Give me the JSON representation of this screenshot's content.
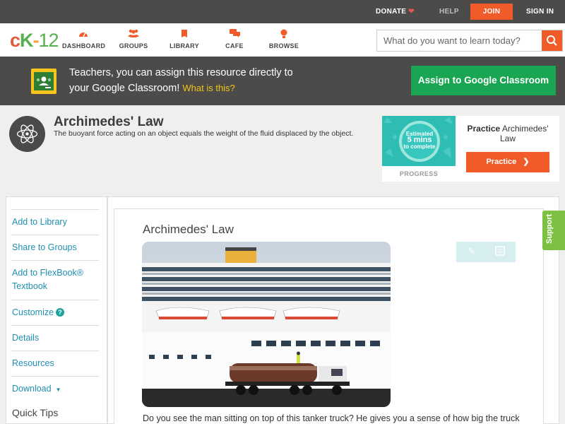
{
  "topbar": {
    "donate": "DONATE",
    "help": "HELP",
    "join": "JOIN",
    "signin": "SIGN IN"
  },
  "nav": {
    "logo": {
      "c": "c",
      "k": "K",
      "n": "12"
    },
    "items": [
      {
        "label": "DASHBOARD",
        "icon": "dashboard-icon"
      },
      {
        "label": "GROUPS",
        "icon": "groups-icon"
      },
      {
        "label": "LIBRARY",
        "icon": "library-icon"
      },
      {
        "label": "CAFE",
        "icon": "cafe-icon"
      },
      {
        "label": "BROWSE",
        "icon": "browse-icon"
      }
    ],
    "search_placeholder": "What do you want to learn today?"
  },
  "banner": {
    "line1": "Teachers, you can assign this resource directly to",
    "line2": "your Google Classroom!",
    "what": "What is this?",
    "assign": "Assign to Google Classroom"
  },
  "concept": {
    "title": "Archimedes' Law",
    "description": "The buoyant force acting on an object equals the weight of the fluid displaced by the object."
  },
  "practice": {
    "estimated": "Estimated",
    "mins": "5 mins",
    "to_complete": "to complete",
    "progress": "PROGRESS",
    "title_bold": "Practice",
    "title_rest": "Archimedes' Law",
    "button": "Practice"
  },
  "sidebar": {
    "items": [
      {
        "label": "Add to Library"
      },
      {
        "label": "Share to Groups"
      },
      {
        "label": "Add to FlexBook® Textbook"
      },
      {
        "label": "Customize"
      },
      {
        "label": "Details"
      },
      {
        "label": "Resources"
      },
      {
        "label": "Download"
      }
    ],
    "quick_tips": "Quick Tips"
  },
  "main": {
    "title": "Archimedes' Law",
    "body": "Do you see the man sitting on top of this tanker truck? He gives you a sense of how big the truck"
  },
  "support": "Support",
  "colors": {
    "accent": "#f15a29",
    "link": "#1f8fb1",
    "assign_green": "#1aa553",
    "support_green": "#7cc142"
  }
}
